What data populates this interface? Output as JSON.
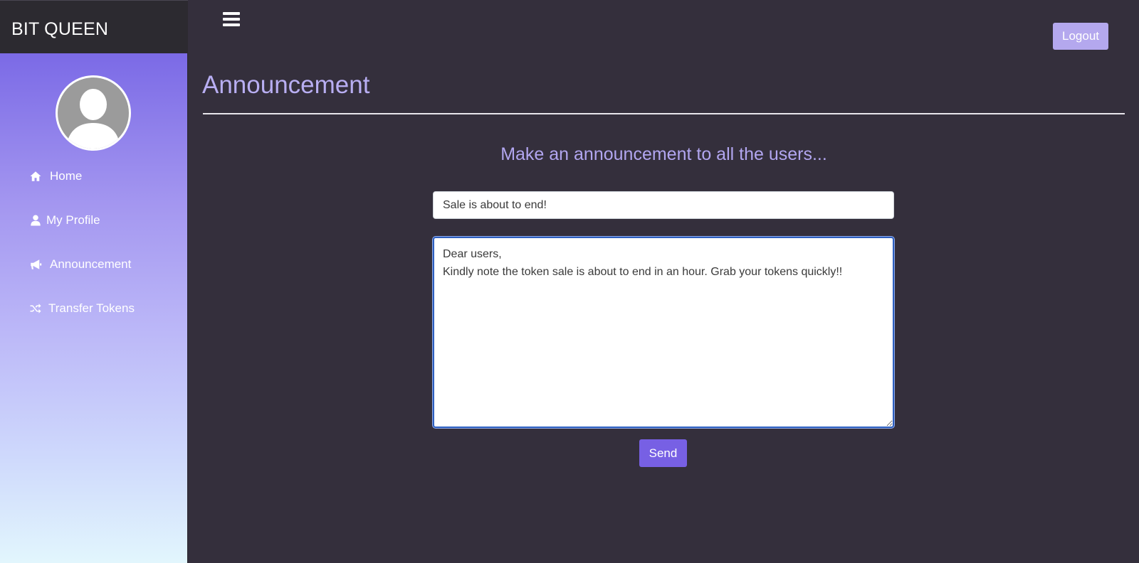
{
  "app": {
    "brand": "BIT QUEEN"
  },
  "sidebar": {
    "items": [
      {
        "label": "Home",
        "icon": "home-icon"
      },
      {
        "label": "My Profile",
        "icon": "user-icon"
      },
      {
        "label": "Announcement",
        "icon": "bullhorn-icon"
      },
      {
        "label": "Transfer Tokens",
        "icon": "shuffle-icon"
      }
    ]
  },
  "header": {
    "logout_label": "Logout"
  },
  "main": {
    "title": "Announcement",
    "subheading": "Make an announcement to all the users...",
    "subject_value": "Sale is about to end!",
    "message_lines": [
      "Dear users,",
      "Kindly note the token sale is about to end in an hour. Grab your tokens quickly!!"
    ],
    "send_label": "Send"
  },
  "colors": {
    "accent": "#7760e4",
    "title": "#b8aef2",
    "background": "#342f3c"
  }
}
